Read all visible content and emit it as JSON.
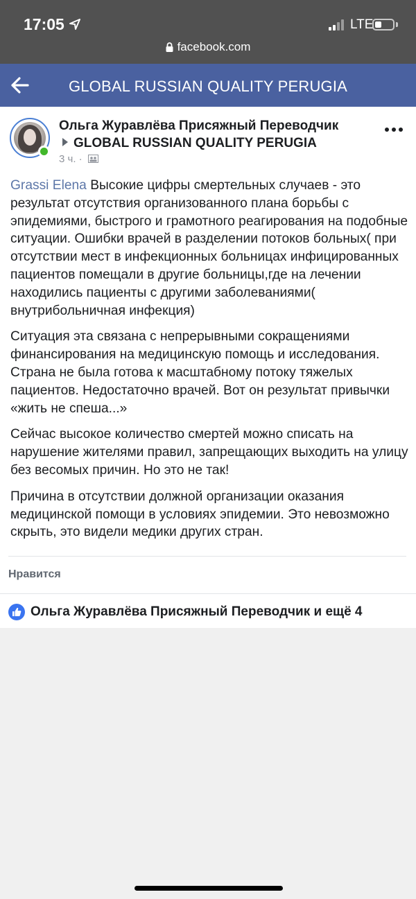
{
  "status_bar": {
    "time": "17:05",
    "network": "LTE",
    "url": "facebook.com"
  },
  "header": {
    "title": "GLOBAL RUSSIAN QUALITY PERUGIA"
  },
  "post": {
    "author": "Ольга Журавлёва Присяжный Переводчик",
    "group": "GLOBAL RUSSIAN QUALITY PERUGIA",
    "time_ago": "3 ч. ·",
    "mention": "Grassi Elena",
    "paragraph_1": "Высокие цифры смертельных случаев - это результат отсутствия организованного плана борьбы с эпидемиями, быстрого и грамотного реагирования на подобные ситуации. Ошибки врачей в разделении потоков больных( при отсутствии мест в инфекционных больницах инфицированных пациентов помещали в другие больницы,где на лечении находились пациенты с другими заболеваниями( внутрибольничная инфекция)",
    "paragraph_2": "Ситуация эта связана с непрерывными сокращениями финансирования на медицинскую помощь и исследования. Страна не была готова к масштабному потоку тяжелых пациентов. Недостаточно врачей. Вот он результат привычки «жить не спеша...»",
    "paragraph_3": "Сейчас высокое количество смертей можно списать на нарушение жителями правил, запрещающих выходить на улицу без весомых причин. Но это не так!",
    "paragraph_4": "Причина в отсутствии должной организации оказания медицинской помощи в условиях эпидемии. Это невозможно скрыть, это видели медики других стран.",
    "like_label": "Нравится",
    "reactions_text": "Ольга Журавлёва Присяжный Переводчик и ещё 4"
  },
  "colors": {
    "header_bg": "#4a61a0",
    "status_bg": "#515151",
    "mention": "#5d77a8",
    "online": "#42b72a",
    "like_icon": "#3a74f0"
  }
}
